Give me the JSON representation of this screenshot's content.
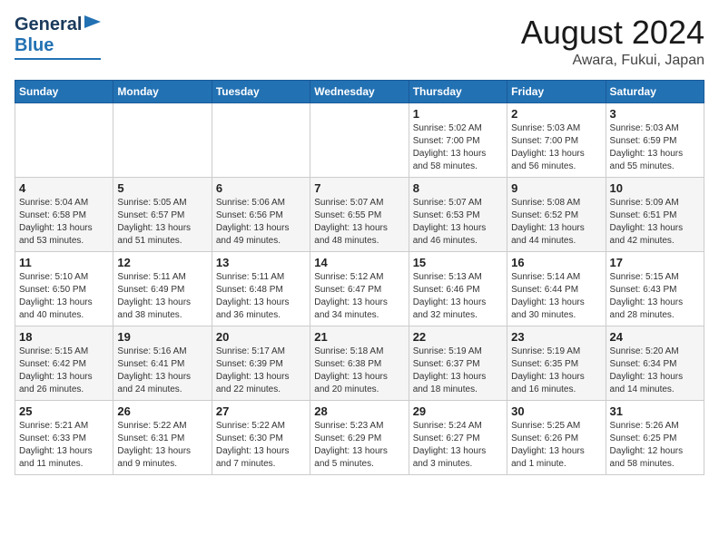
{
  "header": {
    "logo_general": "General",
    "logo_blue": "Blue",
    "month_title": "August 2024",
    "location": "Awara, Fukui, Japan"
  },
  "days_of_week": [
    "Sunday",
    "Monday",
    "Tuesday",
    "Wednesday",
    "Thursday",
    "Friday",
    "Saturday"
  ],
  "weeks": [
    {
      "days": [
        {
          "num": "",
          "info": ""
        },
        {
          "num": "",
          "info": ""
        },
        {
          "num": "",
          "info": ""
        },
        {
          "num": "",
          "info": ""
        },
        {
          "num": "1",
          "info": "Sunrise: 5:02 AM\nSunset: 7:00 PM\nDaylight: 13 hours\nand 58 minutes."
        },
        {
          "num": "2",
          "info": "Sunrise: 5:03 AM\nSunset: 7:00 PM\nDaylight: 13 hours\nand 56 minutes."
        },
        {
          "num": "3",
          "info": "Sunrise: 5:03 AM\nSunset: 6:59 PM\nDaylight: 13 hours\nand 55 minutes."
        }
      ]
    },
    {
      "days": [
        {
          "num": "4",
          "info": "Sunrise: 5:04 AM\nSunset: 6:58 PM\nDaylight: 13 hours\nand 53 minutes."
        },
        {
          "num": "5",
          "info": "Sunrise: 5:05 AM\nSunset: 6:57 PM\nDaylight: 13 hours\nand 51 minutes."
        },
        {
          "num": "6",
          "info": "Sunrise: 5:06 AM\nSunset: 6:56 PM\nDaylight: 13 hours\nand 49 minutes."
        },
        {
          "num": "7",
          "info": "Sunrise: 5:07 AM\nSunset: 6:55 PM\nDaylight: 13 hours\nand 48 minutes."
        },
        {
          "num": "8",
          "info": "Sunrise: 5:07 AM\nSunset: 6:53 PM\nDaylight: 13 hours\nand 46 minutes."
        },
        {
          "num": "9",
          "info": "Sunrise: 5:08 AM\nSunset: 6:52 PM\nDaylight: 13 hours\nand 44 minutes."
        },
        {
          "num": "10",
          "info": "Sunrise: 5:09 AM\nSunset: 6:51 PM\nDaylight: 13 hours\nand 42 minutes."
        }
      ]
    },
    {
      "days": [
        {
          "num": "11",
          "info": "Sunrise: 5:10 AM\nSunset: 6:50 PM\nDaylight: 13 hours\nand 40 minutes."
        },
        {
          "num": "12",
          "info": "Sunrise: 5:11 AM\nSunset: 6:49 PM\nDaylight: 13 hours\nand 38 minutes."
        },
        {
          "num": "13",
          "info": "Sunrise: 5:11 AM\nSunset: 6:48 PM\nDaylight: 13 hours\nand 36 minutes."
        },
        {
          "num": "14",
          "info": "Sunrise: 5:12 AM\nSunset: 6:47 PM\nDaylight: 13 hours\nand 34 minutes."
        },
        {
          "num": "15",
          "info": "Sunrise: 5:13 AM\nSunset: 6:46 PM\nDaylight: 13 hours\nand 32 minutes."
        },
        {
          "num": "16",
          "info": "Sunrise: 5:14 AM\nSunset: 6:44 PM\nDaylight: 13 hours\nand 30 minutes."
        },
        {
          "num": "17",
          "info": "Sunrise: 5:15 AM\nSunset: 6:43 PM\nDaylight: 13 hours\nand 28 minutes."
        }
      ]
    },
    {
      "days": [
        {
          "num": "18",
          "info": "Sunrise: 5:15 AM\nSunset: 6:42 PM\nDaylight: 13 hours\nand 26 minutes."
        },
        {
          "num": "19",
          "info": "Sunrise: 5:16 AM\nSunset: 6:41 PM\nDaylight: 13 hours\nand 24 minutes."
        },
        {
          "num": "20",
          "info": "Sunrise: 5:17 AM\nSunset: 6:39 PM\nDaylight: 13 hours\nand 22 minutes."
        },
        {
          "num": "21",
          "info": "Sunrise: 5:18 AM\nSunset: 6:38 PM\nDaylight: 13 hours\nand 20 minutes."
        },
        {
          "num": "22",
          "info": "Sunrise: 5:19 AM\nSunset: 6:37 PM\nDaylight: 13 hours\nand 18 minutes."
        },
        {
          "num": "23",
          "info": "Sunrise: 5:19 AM\nSunset: 6:35 PM\nDaylight: 13 hours\nand 16 minutes."
        },
        {
          "num": "24",
          "info": "Sunrise: 5:20 AM\nSunset: 6:34 PM\nDaylight: 13 hours\nand 14 minutes."
        }
      ]
    },
    {
      "days": [
        {
          "num": "25",
          "info": "Sunrise: 5:21 AM\nSunset: 6:33 PM\nDaylight: 13 hours\nand 11 minutes."
        },
        {
          "num": "26",
          "info": "Sunrise: 5:22 AM\nSunset: 6:31 PM\nDaylight: 13 hours\nand 9 minutes."
        },
        {
          "num": "27",
          "info": "Sunrise: 5:22 AM\nSunset: 6:30 PM\nDaylight: 13 hours\nand 7 minutes."
        },
        {
          "num": "28",
          "info": "Sunrise: 5:23 AM\nSunset: 6:29 PM\nDaylight: 13 hours\nand 5 minutes."
        },
        {
          "num": "29",
          "info": "Sunrise: 5:24 AM\nSunset: 6:27 PM\nDaylight: 13 hours\nand 3 minutes."
        },
        {
          "num": "30",
          "info": "Sunrise: 5:25 AM\nSunset: 6:26 PM\nDaylight: 13 hours\nand 1 minute."
        },
        {
          "num": "31",
          "info": "Sunrise: 5:26 AM\nSunset: 6:25 PM\nDaylight: 12 hours\nand 58 minutes."
        }
      ]
    }
  ]
}
